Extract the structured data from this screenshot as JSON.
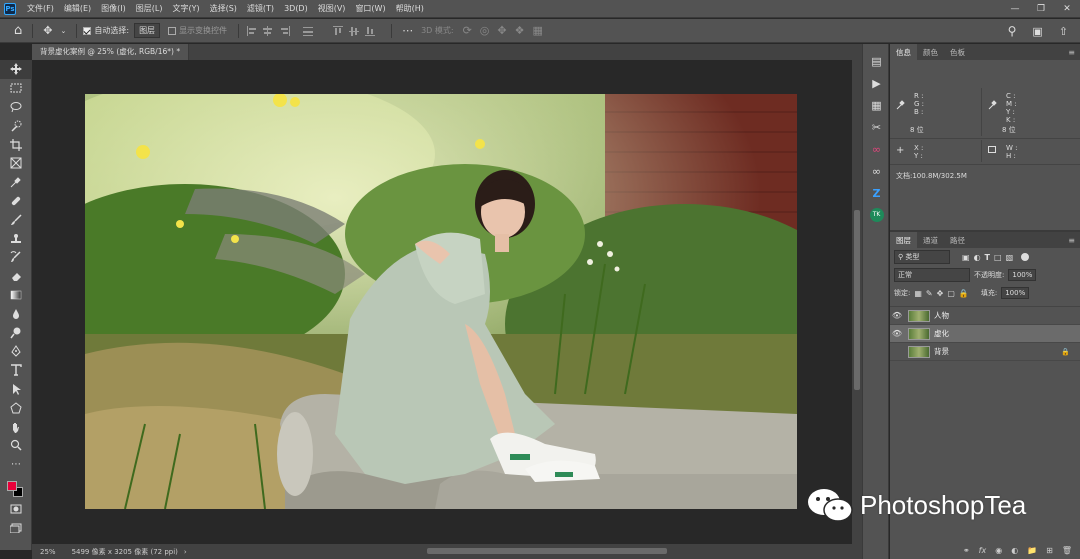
{
  "app": {
    "logo": "Ps"
  },
  "menu": [
    "文件(F)",
    "编辑(E)",
    "图像(I)",
    "图层(L)",
    "文字(Y)",
    "选择(S)",
    "滤镜(T)",
    "3D(D)",
    "视图(V)",
    "窗口(W)",
    "帮助(H)"
  ],
  "options": {
    "auto_select_label": "自动选择:",
    "auto_select_value": "图层",
    "transform_label": "显示变换控件",
    "mode_3d_label": "3D 模式:"
  },
  "document": {
    "tab_title": "背景虚化案例 @ 25% (虚化, RGB/16*) *"
  },
  "status": {
    "zoom": "25%",
    "doc_info": "5499 像素 x 3205 像素 (72 ppi)"
  },
  "info_panel": {
    "tabs": [
      "信息",
      "颜色",
      "色板"
    ],
    "rgb": "R :\nG :\nB :",
    "bits_left": "8 位",
    "cmyk": "C :\nM :\nY :\nK :",
    "bits_right": "8 位",
    "xy": "X :\nY :",
    "wh": "W :\nH :",
    "doc_size": "文档:100.8M/302.5M"
  },
  "layers_panel": {
    "tabs": [
      "图层",
      "通道",
      "路径"
    ],
    "filter_kind": "类型",
    "blend_mode": "正常",
    "opacity_label": "不透明度:",
    "opacity_value": "100%",
    "lock_label": "锁定:",
    "fill_label": "填充:",
    "fill_value": "100%",
    "layers": [
      {
        "name": "人物",
        "visible": true,
        "selected": false,
        "locked": false
      },
      {
        "name": "虚化",
        "visible": true,
        "selected": true,
        "locked": false
      },
      {
        "name": "背景",
        "visible": false,
        "selected": false,
        "locked": true
      }
    ]
  },
  "watermark": {
    "text": "PhotoshopTea"
  },
  "colors": {
    "foreground": "#e8003a",
    "background": "#000000"
  }
}
